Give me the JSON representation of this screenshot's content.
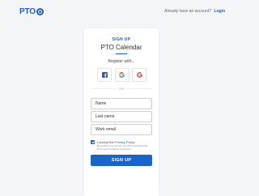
{
  "header": {
    "logo_text": "PTO",
    "account_prompt": "Already have an account?",
    "login_link": "Login"
  },
  "card": {
    "overline": "SIGN UP",
    "title": "PTO Calendar",
    "register_with": "Register with...",
    "social": [
      {
        "icon": "facebook-icon",
        "color": "#3b5998"
      },
      {
        "icon": "google-icon",
        "color": "#4285f4"
      },
      {
        "icon": "google-plus-icon",
        "color": "#db4437"
      }
    ],
    "divider": "OR",
    "fields": {
      "name_placeholder": "Name",
      "lastname_placeholder": "Last name",
      "email_placeholder": "Work email"
    },
    "consent": {
      "checked": true,
      "accept_prefix": "I accept the",
      "privacy_link": "Privacy Policy",
      "fine_print": "By creating your account you will be accepting the Terms and Conditions of Invoicely."
    },
    "submit_label": "SIGN UP"
  },
  "colors": {
    "accent": "#1f5fbf",
    "button": "#1a64c6",
    "background": "#f4f5f8"
  }
}
